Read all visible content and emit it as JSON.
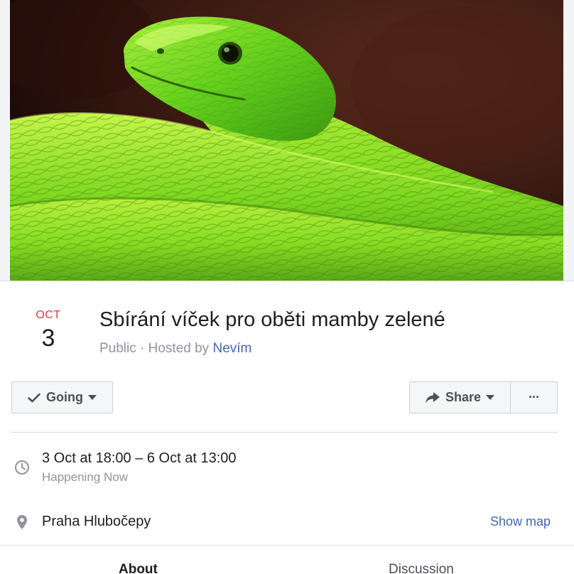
{
  "cover": {
    "icon": "green-mamba-cover-photo",
    "colors": {
      "background": "#2a120c",
      "snake_light": "#b8f03a",
      "snake_mid": "#6fd81e",
      "snake_dark": "#3e8f10"
    }
  },
  "event": {
    "date": {
      "month": "OCT",
      "day": "3"
    },
    "title": "Sbírání víček pro oběti mamby zelené",
    "meta": {
      "privacy": "Public",
      "separator": " · ",
      "hosted_by_prefix": "Hosted by ",
      "host": "Nevím"
    }
  },
  "actions": {
    "going_label": "Going",
    "share_label": "Share",
    "more_label": "···"
  },
  "details": {
    "time": {
      "main": "3 Oct at 18:00 – 6 Oct at 13:00",
      "status": "Happening Now"
    },
    "location": {
      "name": "Praha Hlubočepy",
      "show_map_label": "Show map"
    }
  },
  "tabs": [
    {
      "label": "About",
      "active": true
    },
    {
      "label": "Discussion",
      "active": false
    }
  ],
  "theme": {
    "accent": "#4267b2",
    "date_red": "#e0393e",
    "muted_text": "#90949c"
  }
}
